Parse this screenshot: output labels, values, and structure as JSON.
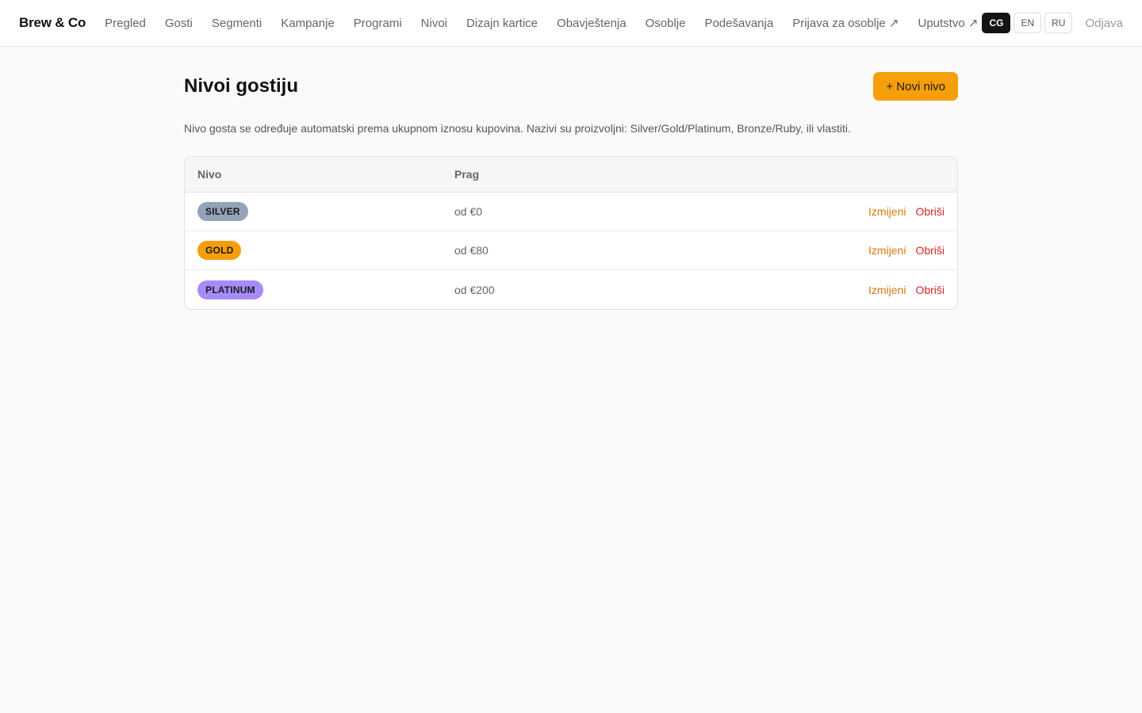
{
  "brand": "Brew & Co",
  "nav": [
    {
      "label": "Pregled"
    },
    {
      "label": "Gosti"
    },
    {
      "label": "Segmenti"
    },
    {
      "label": "Kampanje"
    },
    {
      "label": "Programi"
    },
    {
      "label": "Nivoi"
    },
    {
      "label": "Dizajn kartice"
    },
    {
      "label": "Obavještenja"
    },
    {
      "label": "Osoblje"
    },
    {
      "label": "Podešavanja"
    },
    {
      "label": "Prijava za osoblje ↗"
    },
    {
      "label": "Uputstvo ↗"
    }
  ],
  "languages": [
    {
      "code": "CG",
      "active": true
    },
    {
      "code": "EN",
      "active": false
    },
    {
      "code": "RU",
      "active": false
    }
  ],
  "logout_label": "Odjava",
  "page": {
    "title": "Nivoi gostiju",
    "new_button": "+ Novi nivo",
    "description": "Nivo gosta se određuje automatski prema ukupnom iznosu kupovina. Nazivi su proizvoljni: Silver/Gold/Platinum, Bronze/Ruby, ili vlastiti."
  },
  "table": {
    "headers": {
      "level": "Nivo",
      "threshold": "Prag"
    },
    "rows": [
      {
        "name": "SILVER",
        "color": "#94a3b8",
        "threshold": "od €0",
        "edit": "Izmijeni",
        "delete": "Obriši"
      },
      {
        "name": "GOLD",
        "color": "#f59e0b",
        "threshold": "od €80",
        "edit": "Izmijeni",
        "delete": "Obriši"
      },
      {
        "name": "PLATINUM",
        "color": "#a78bfa",
        "threshold": "od €200",
        "edit": "Izmijeni",
        "delete": "Obriši"
      }
    ]
  }
}
